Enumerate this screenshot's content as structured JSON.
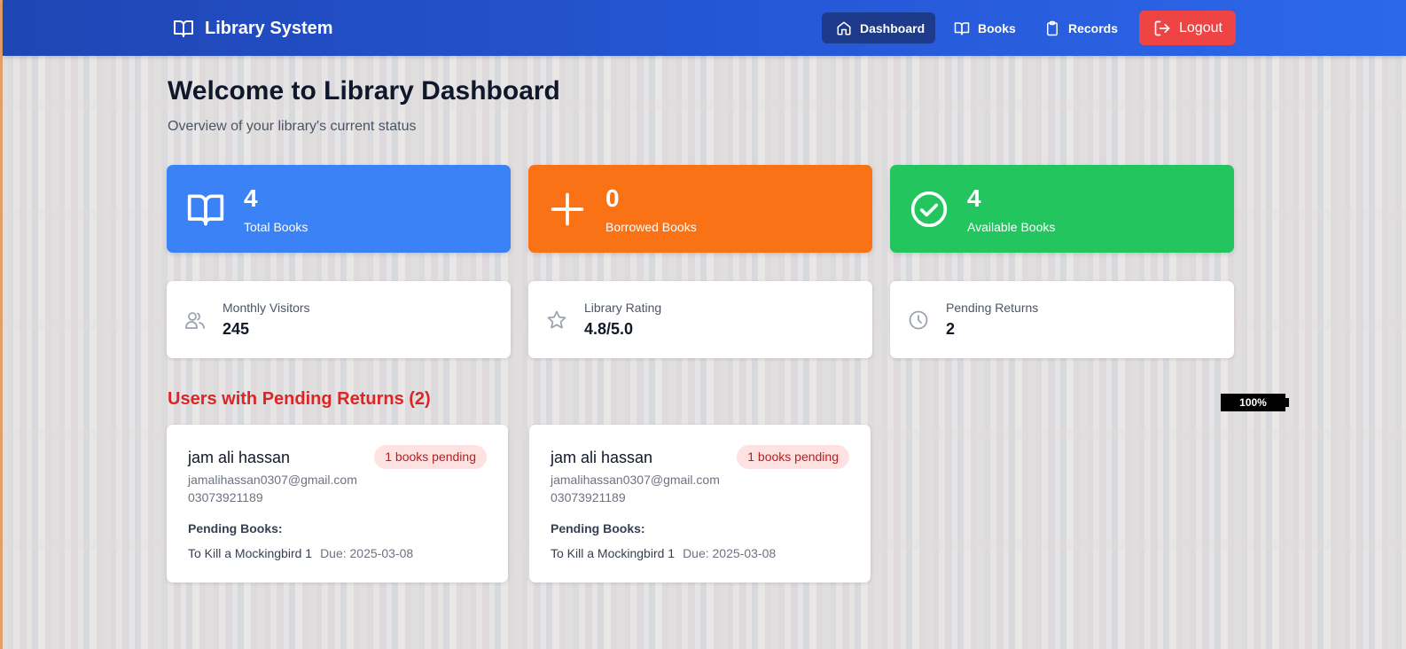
{
  "nav": {
    "brand": "Library System",
    "items": [
      {
        "label": "Dashboard",
        "icon": "home-icon",
        "active": true
      },
      {
        "label": "Books",
        "icon": "book-icon"
      },
      {
        "label": "Records",
        "icon": "clipboard-icon"
      }
    ],
    "logout_label": "Logout"
  },
  "page": {
    "title": "Welcome to Library Dashboard",
    "subtitle": "Overview of your library's current status"
  },
  "stats": [
    {
      "value": "4",
      "label": "Total Books",
      "color": "#3b82f6",
      "icon": "book-open-icon"
    },
    {
      "value": "0",
      "label": "Borrowed Books",
      "color": "#f97316",
      "icon": "plus-icon"
    },
    {
      "value": "4",
      "label": "Available Books",
      "color": "#22c55e",
      "icon": "check-circle-icon"
    }
  ],
  "info": [
    {
      "label": "Monthly Visitors",
      "value": "245",
      "icon": "users-icon"
    },
    {
      "label": "Library Rating",
      "value": "4.8/5.0",
      "icon": "star-icon"
    },
    {
      "label": "Pending Returns",
      "value": "2",
      "icon": "clock-icon"
    }
  ],
  "pending": {
    "title": "Users with Pending Returns (2)",
    "users": [
      {
        "name": "jam ali hassan",
        "email": "jamalihassan0307@gmail.com",
        "phone": "03073921189",
        "badge": "1 books pending",
        "books_heading": "Pending Books:",
        "book_title": "To Kill a Mockingbird 1",
        "due": "Due: 2025-03-08"
      },
      {
        "name": "jam ali hassan",
        "email": "jamalihassan0307@gmail.com",
        "phone": "03073921189",
        "badge": "1 books pending",
        "books_heading": "Pending Books:",
        "book_title": "To Kill a Mockingbird 1",
        "due": "Due: 2025-03-08"
      }
    ]
  },
  "zoom": "100%"
}
